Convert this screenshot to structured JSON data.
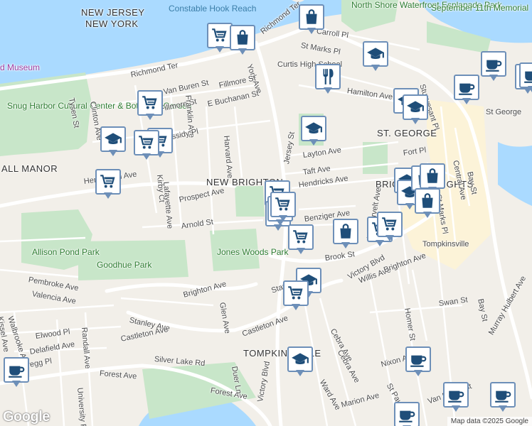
{
  "map": {
    "logo": "Google",
    "attribution": "Map data ©2025 Google"
  },
  "place_labels": [
    {
      "text": "NEW JERSEY",
      "cls": "place"
    },
    {
      "text": "NEW YORK",
      "cls": "place"
    },
    {
      "text": "NEW BRIGHTON",
      "cls": "place"
    },
    {
      "text": "ST. GEORGE",
      "cls": "place"
    },
    {
      "text": "ALL MANOR",
      "cls": "place"
    },
    {
      "text": "TOMPKINSVILLE",
      "cls": "place"
    },
    {
      "text": "BRIGHTON HEIGHTS",
      "cls": "place"
    }
  ],
  "poi_labels": [
    {
      "text": "Constable Hook Reach",
      "cls": "water"
    },
    {
      "text": "North Shore Waterfront Esplanade Park",
      "cls": "park"
    },
    {
      "text": "September 11th Memorial",
      "cls": "park"
    },
    {
      "text": "d Museum",
      "cls": "museum"
    },
    {
      "text": "Snug Harbor Cultural Center & Botanical Garden",
      "cls": "park"
    },
    {
      "text": "Curtis High School",
      "cls": ""
    },
    {
      "text": "St George",
      "cls": ""
    },
    {
      "text": "Allison Pond Park",
      "cls": "park"
    },
    {
      "text": "Goodhue Park",
      "cls": "park"
    },
    {
      "text": "Jones Woods Park",
      "cls": "park"
    },
    {
      "text": "Tompkinsville",
      "cls": ""
    }
  ],
  "streets": [
    "Richmond Ter",
    "Richmond Ter",
    "York Ave",
    "Carroll Pl",
    "St Marks Pl",
    "Hamilton Ave",
    "Stuyvesant Pl",
    "Tysen St",
    "Clinton Ave",
    "Van Buren St",
    "Fillmore St",
    "Fillmore St",
    "Franklin Ave",
    "E Buchanan St",
    "Cassidy Pl",
    "Harvard Ave",
    "Hendricks Ave",
    "Layton Ave",
    "Taft Ave",
    "Fort Pl",
    "Central Ave",
    "Bay St",
    "Kirby Ct",
    "Lafayette Ave",
    "Henderson Ave",
    "Prospect Ave",
    "Arnold St",
    "Brook St",
    "Victory Blvd",
    "Willis Ave",
    "Swan St",
    "Homer St",
    "Pembroke Ave",
    "Valencia Ave",
    "Stanley Ave",
    "Castleton Ave",
    "Brighton Ave",
    "Glen Ave",
    "Elwood Pl",
    "Delafield Ave",
    "Gregg Pl",
    "Walbrooke Ave",
    "Randall Ave",
    "Kissel Ave",
    "Silver Lake Rd",
    "Forest Ave",
    "Forest Ave",
    "Duer Ln",
    "University Pl",
    "Cebra Ave",
    "Ward Ave",
    "Marion Ave",
    "Nixon Ave",
    "St Paul's Ave",
    "Van Duzer St",
    "Murray Hulbert Ave",
    "Stanley Ave",
    "Jersey St",
    "Victory Blvd",
    "St Marks Pl",
    "Westervelt Ave",
    "Benziger Ave",
    "Castleton Ave",
    "Brighton Ave",
    "Cebra Ave",
    "Bay St"
  ],
  "markers": [
    {
      "icon": "cart"
    },
    {
      "icon": "bag"
    },
    {
      "icon": "bag"
    },
    {
      "icon": "school"
    },
    {
      "icon": "coffee"
    },
    {
      "icon": "coffee"
    },
    {
      "icon": "coffee"
    },
    {
      "icon": "fork"
    },
    {
      "icon": "cart"
    },
    {
      "icon": "school"
    },
    {
      "icon": "school"
    },
    {
      "icon": "cart"
    },
    {
      "icon": "cart"
    },
    {
      "icon": "school"
    },
    {
      "icon": "school"
    },
    {
      "icon": "cart"
    },
    {
      "icon": "school"
    },
    {
      "icon": "school"
    },
    {
      "icon": "bag"
    },
    {
      "icon": "bag"
    },
    {
      "icon": "cart"
    },
    {
      "icon": "fork"
    },
    {
      "icon": "cart"
    },
    {
      "icon": "bag"
    },
    {
      "icon": "cart"
    },
    {
      "icon": "bag"
    },
    {
      "icon": "cart"
    },
    {
      "icon": "cart"
    },
    {
      "icon": "cart"
    },
    {
      "icon": "school"
    },
    {
      "icon": "cart"
    },
    {
      "icon": "school"
    },
    {
      "icon": "coffee"
    },
    {
      "icon": "coffee"
    },
    {
      "icon": "coffee"
    },
    {
      "icon": "coffee"
    },
    {
      "icon": "coffee"
    },
    {
      "icon": "coffee"
    }
  ]
}
